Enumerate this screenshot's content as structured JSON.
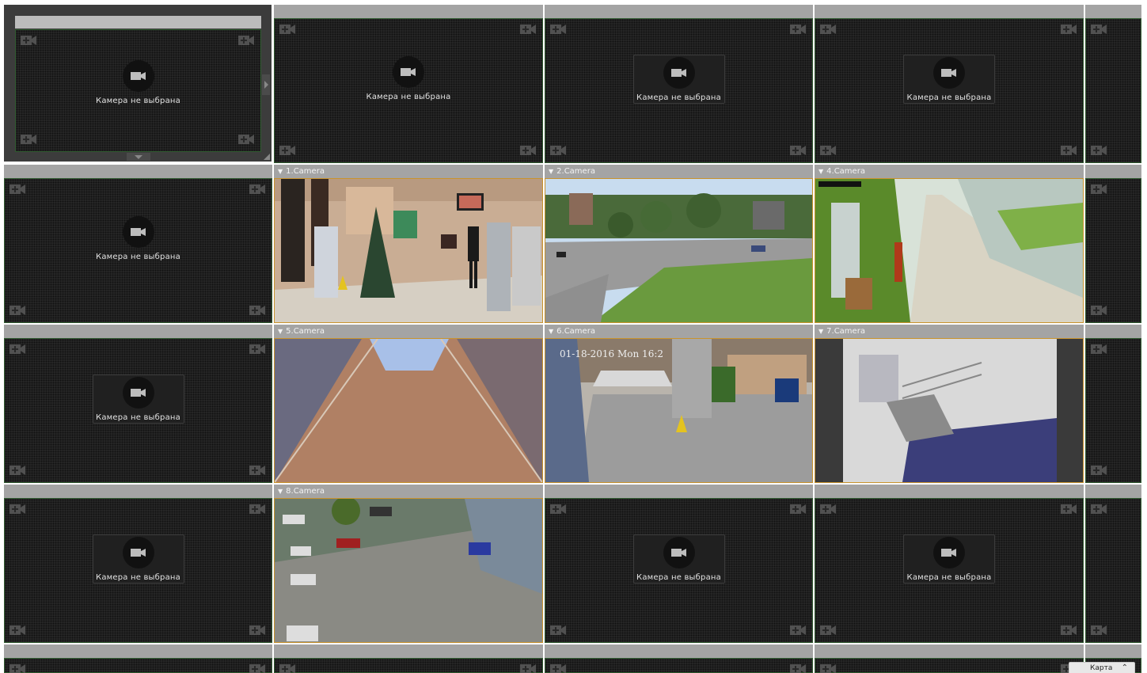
{
  "layout": {
    "empty_label": "Камера не выбрана",
    "cameras": [
      {
        "title": "1.Camera",
        "scene": "lobby"
      },
      {
        "title": "2.Camera",
        "scene": "campus"
      },
      {
        "title": "4.Camera",
        "scene": "corridor"
      },
      {
        "title": "5.Camera",
        "scene": "tunnel"
      },
      {
        "title": "6.Camera",
        "scene": "atrium",
        "overlay": "01-18-2016 Mon 16:2"
      },
      {
        "title": "7.Camera",
        "scene": "stairs"
      },
      {
        "title": "8.Camera",
        "scene": "parking"
      }
    ]
  },
  "map_button": {
    "label": "Карта"
  },
  "colors": {
    "accent_selected": "#c9932c",
    "empty_border": "#2f5a2f",
    "title_bar": "#a4a4a4"
  }
}
